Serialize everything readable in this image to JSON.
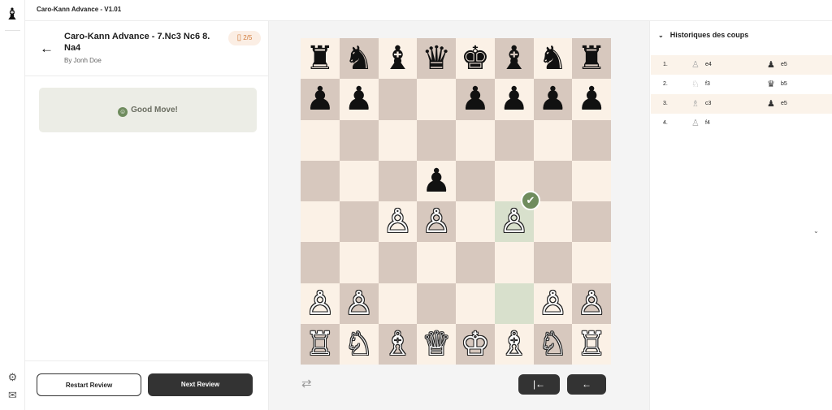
{
  "app": {
    "title": "Caro-Kann Advance - V1.01",
    "logo_icon": "♝"
  },
  "rail": {
    "settings_icon": "⚙",
    "mail_icon": "✉"
  },
  "lesson": {
    "title": "Caro-Kann Advance - 7.Nc3 Nc6 8. Na4",
    "author": "By Jonh Doe",
    "progress": "2/5",
    "back_icon": "←",
    "book_icon": "📖"
  },
  "feedback": {
    "text": "Good Move!",
    "icon": "☺",
    "color": "#6f8c5e"
  },
  "footer": {
    "restart_label": "Restart Review",
    "next_label": "Next Review"
  },
  "board": {
    "light_color": "#fbf1e6",
    "dark_color": "#d7c8be",
    "highlight_color": "#d8e0cc",
    "highlights": [
      "f4",
      "f2"
    ],
    "check_square": "f4",
    "check_icon": "✔",
    "ranks": [
      [
        "♜",
        "♞",
        "♝",
        "♛",
        "♚",
        "♝",
        "♞",
        "♜"
      ],
      [
        "♟",
        "♟",
        "",
        "",
        "♟",
        "♟",
        "♟",
        "♟"
      ],
      [
        "",
        "",
        "",
        "",
        "",
        "",
        "",
        ""
      ],
      [
        "",
        "",
        "",
        "♟",
        "",
        "",
        "",
        ""
      ],
      [
        "",
        "",
        "♙",
        "♙",
        "",
        "♙",
        "",
        ""
      ],
      [
        "",
        "",
        "",
        "",
        "",
        "",
        "",
        ""
      ],
      [
        "♙",
        "♙",
        "",
        "",
        "",
        "",
        "♙",
        "♙"
      ],
      [
        "♖",
        "♘",
        "♗",
        "♕",
        "♔",
        "♗",
        "♘",
        "♖"
      ]
    ],
    "flip_icon": "⇄",
    "first_icon": "|←",
    "prev_icon": "←"
  },
  "history": {
    "title": "Historiques des coups",
    "chevron": "⌄",
    "moves": [
      {
        "num": "1.",
        "white_piece": "♙",
        "white": "e4",
        "black_piece": "♟",
        "black": "e5"
      },
      {
        "num": "2.",
        "white_piece": "♘",
        "white": "f3",
        "black_piece": "♛",
        "black": "b5"
      },
      {
        "num": "3.",
        "white_piece": "♗",
        "white": "c3",
        "black_piece": "♟",
        "black": "e5"
      },
      {
        "num": "4.",
        "white_piece": "♙",
        "white": "f4",
        "black_piece": "",
        "black": ""
      }
    ],
    "collapse_icon": "⌄"
  }
}
